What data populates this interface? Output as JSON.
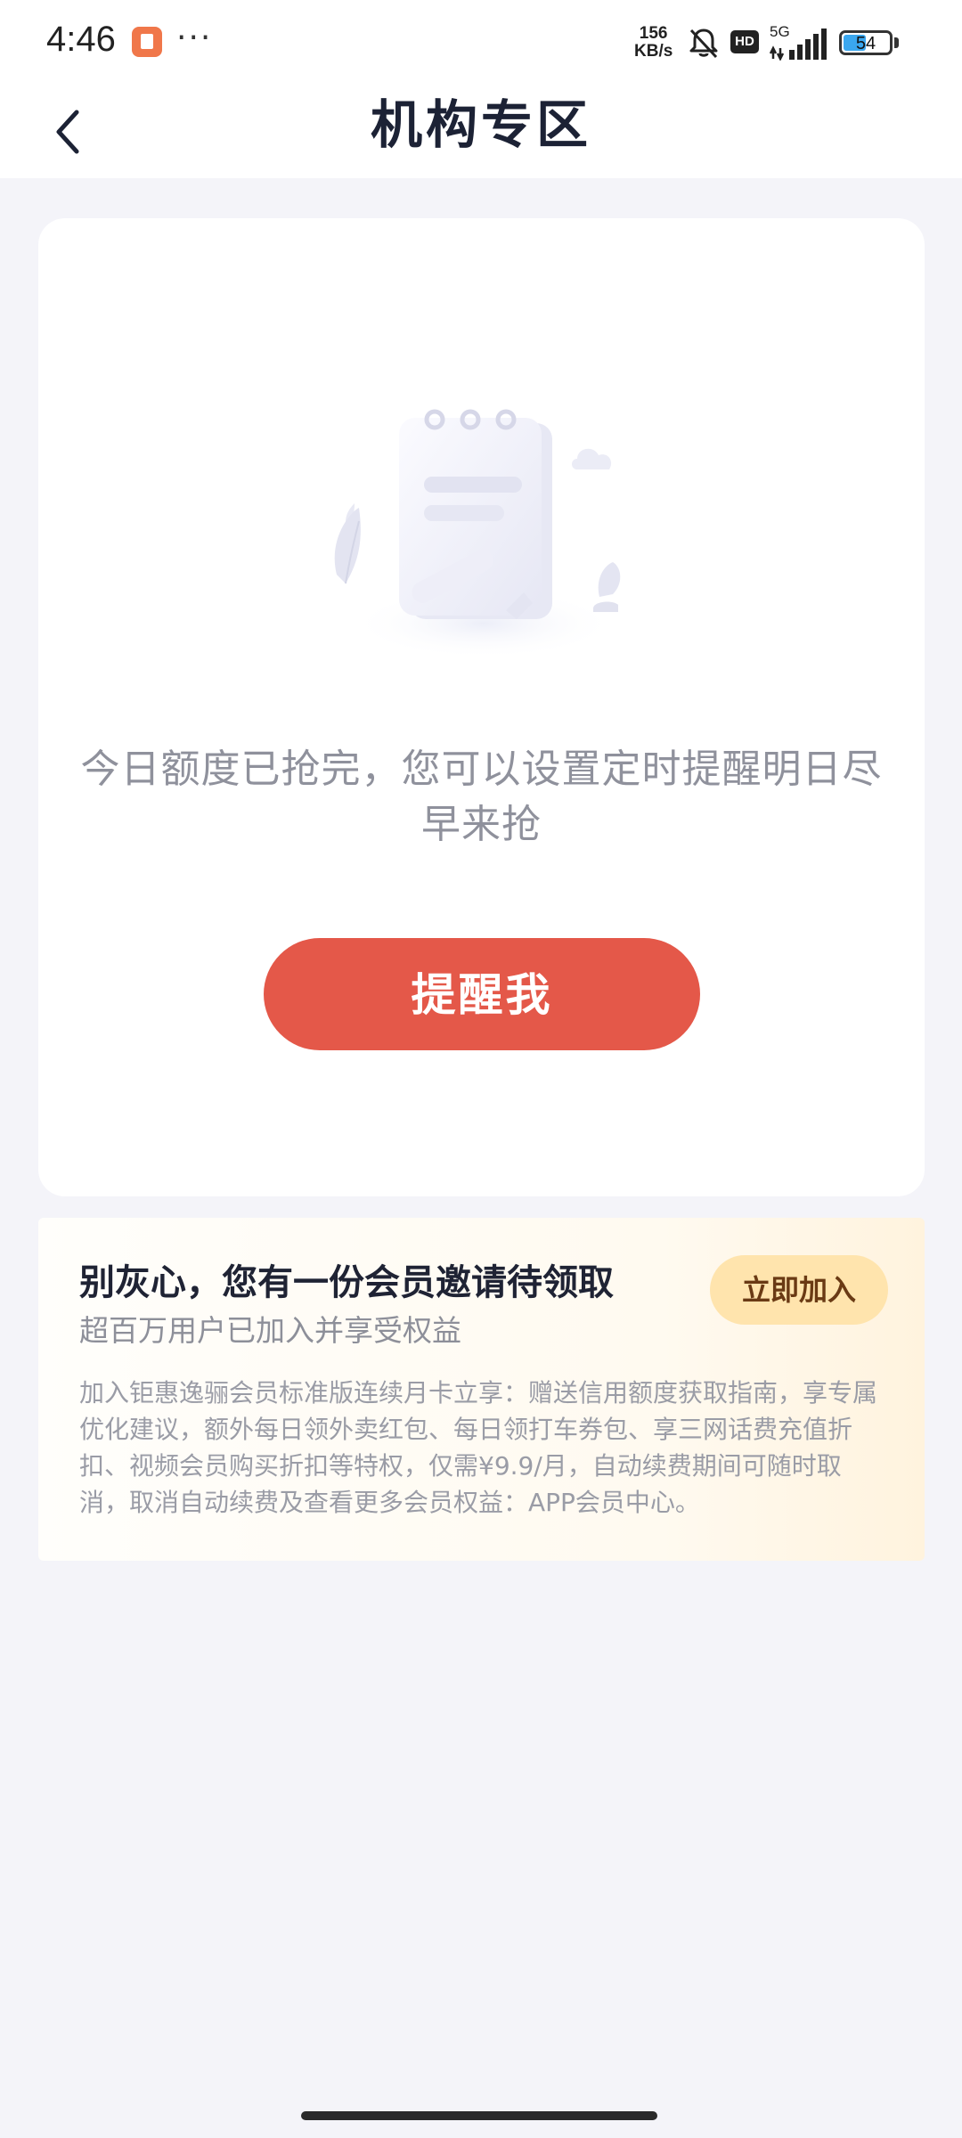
{
  "status_bar": {
    "time": "4:46",
    "more_dots": "···",
    "network_speed_value": "156",
    "network_speed_unit": "KB/s",
    "hd_badge": "HD",
    "network_type": "5G",
    "battery_level": "54",
    "battery_color": "#3aa7ef"
  },
  "nav": {
    "title": "机构专区",
    "back_icon": "chevron-left-icon"
  },
  "main_card": {
    "illustration_icon": "empty-notebook-illustration",
    "empty_message": "今日额度已抢完，您可以设置定时提醒明日尽早来抢",
    "remind_button_label": "提醒我",
    "accent_color": "#e45849"
  },
  "member_card": {
    "title": "别灰心，您有一份会员邀请待领取",
    "subtitle": "超百万用户已加入并享受权益",
    "join_button_label": "立即加入",
    "description": "加入钜惠逸骊会员标准版连续月卡立享：赠送信用额度获取指南，享专属优化建议，额外每日领外卖红包、每日领打车券包、享三网话费充值折扣、视频会员购买折扣等特权，仅需¥9.9/月，自动续费期间可随时取消，取消自动续费及查看更多会员权益：APP会员中心。"
  }
}
